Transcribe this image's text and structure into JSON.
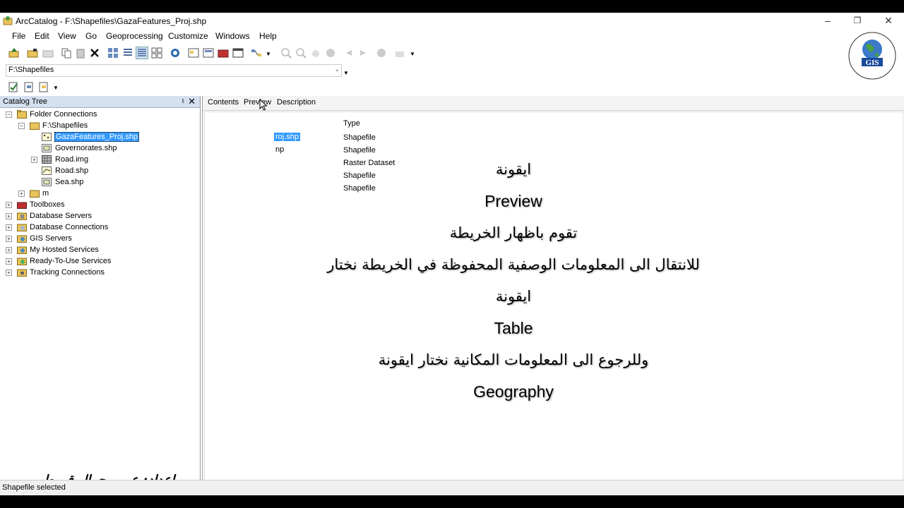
{
  "window": {
    "title": "ArcCatalog - F:\\Shapefiles\\GazaFeatures_Proj.shp"
  },
  "menu": [
    "File",
    "Edit",
    "View",
    "Go",
    "Geoprocessing",
    "Customize",
    "Windows",
    "Help"
  ],
  "address": {
    "value": "F:\\Shapefiles"
  },
  "catalog": {
    "title": "Catalog Tree",
    "items": [
      {
        "label": "Folder Connections"
      },
      {
        "label": "F:\\Shapefiles"
      },
      {
        "label": "GazaFeatures_Proj.shp"
      },
      {
        "label": "Governorates.shp"
      },
      {
        "label": "Road.img"
      },
      {
        "label": "Road.shp"
      },
      {
        "label": "Sea.shp"
      },
      {
        "label": "m"
      },
      {
        "label": "Toolboxes"
      },
      {
        "label": "Database Servers"
      },
      {
        "label": "Database Connections"
      },
      {
        "label": "GIS Servers"
      },
      {
        "label": "My Hosted Services"
      },
      {
        "label": "Ready-To-Use Services"
      },
      {
        "label": "Tracking Connections"
      }
    ]
  },
  "tabs": [
    "Contents",
    "Preview",
    "Description"
  ],
  "contents": {
    "type_header": "Type",
    "name_fragments": [
      "roj.shp",
      "np"
    ],
    "types": [
      "Shapefile",
      "Shapefile",
      "Raster Dataset",
      "Shapefile",
      "Shapefile"
    ]
  },
  "overlay": {
    "line1": "ايقونة",
    "line2": "Preview",
    "line3": "تقوم باظهار الخريطة",
    "line4": "للانتقال الى المعلومات الوصفية المحفوظة في الخريطة نختار",
    "line5": "ايقونة",
    "line6": "Table",
    "line7": "وللرجوع الى المعلومات المكانية نختار ايقونة",
    "line8": "Geography"
  },
  "credit": "اعداد: عمرو جمال قروط",
  "status": "Shapefile selected",
  "logo_text": "GIS",
  "colors": {
    "selection": "#3399ff",
    "panel_header": "#d4dff0",
    "folder": "#e8c35a"
  }
}
